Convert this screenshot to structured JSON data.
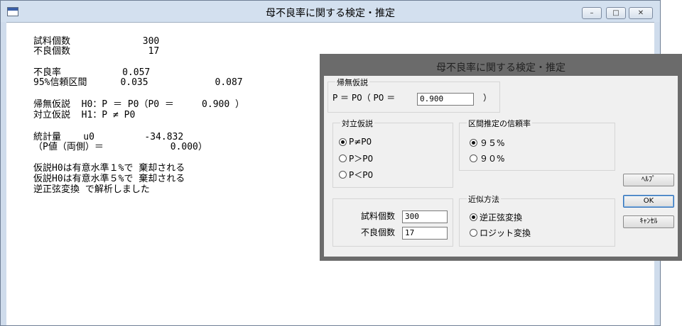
{
  "window": {
    "title": "母不良率に関する検定・推定",
    "minimize": "–",
    "maximize": "□",
    "close": "✕"
  },
  "report": {
    "line1": "試料個数             300",
    "line2": "不良個数              17",
    "line3": "不良率           0.057",
    "line4": "95%信頼区間      0.035            0.087",
    "line5": "帰無仮説  H0：P ＝ P0（P0 ＝     0.900 ）",
    "line6": "対立仮説  H1：P ≠ P0",
    "line7": "統計量    u0         -34.832",
    "line8": "（P値（両側）＝            0.000）",
    "line9": "仮説H0は有意水準１%で 棄却される",
    "line10": "仮説H0は有意水準５%で 棄却される",
    "line11": "逆正弦変換 で解析しました"
  },
  "dialog": {
    "title": "母不良率に関する検定・推定",
    "null_hypothesis": {
      "label": "帰無仮説",
      "prefix": "P ＝ P0（ P0 ＝",
      "value": "0.900",
      "suffix": "）"
    },
    "alternative": {
      "label": "対立仮説",
      "options": [
        "P≠P0",
        "P＞P0",
        "P＜P0"
      ],
      "selected": 0
    },
    "confidence": {
      "label": "区間推定の信頼率",
      "options": [
        "９５%",
        "９０%"
      ],
      "selected": 0
    },
    "sample": {
      "n_label": "試料個数",
      "n_value": "300",
      "defect_label": "不良個数",
      "defect_value": "17"
    },
    "approx": {
      "label": "近似方法",
      "options": [
        "逆正弦変換",
        "ロジット変換"
      ],
      "selected": 0
    },
    "buttons": {
      "help": "ﾍﾙﾌﾟ",
      "ok": "OK",
      "cancel": "ｷｬﾝｾﾙ"
    }
  }
}
